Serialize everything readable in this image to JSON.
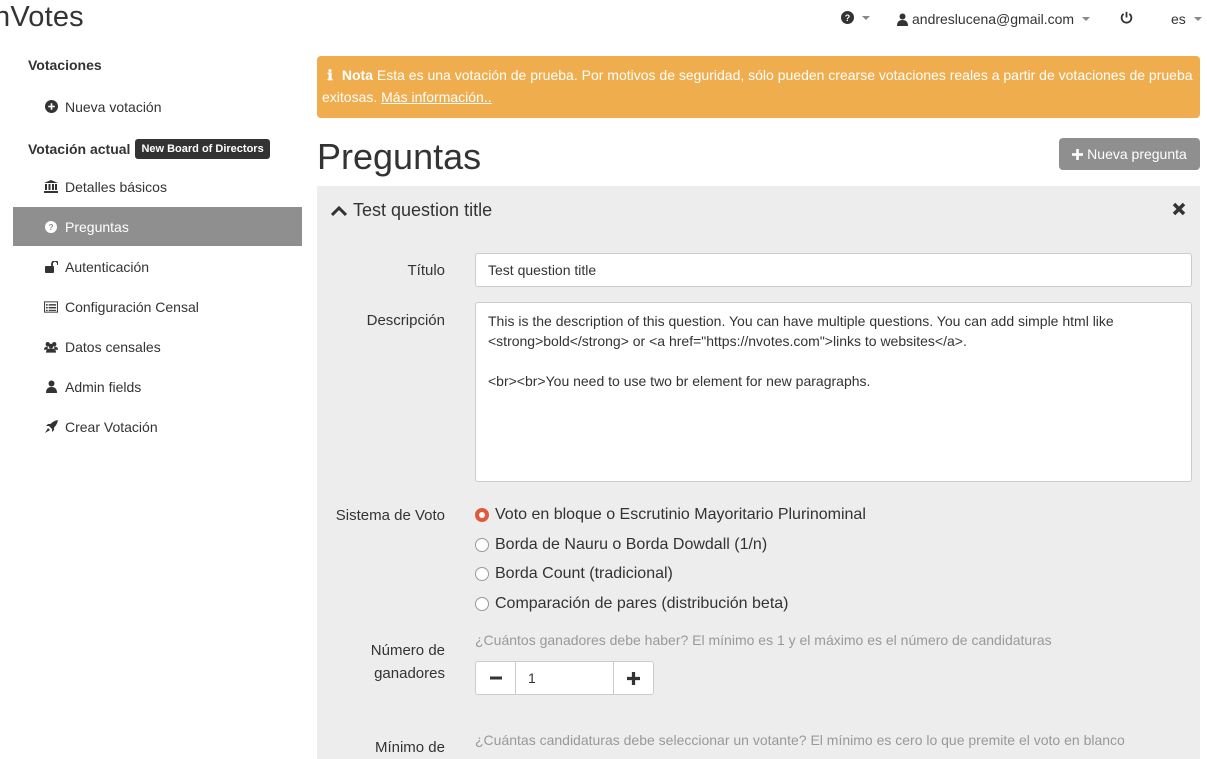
{
  "header": {
    "brand": "nVotes",
    "help_icon": "?",
    "user_email": "andreslucena@gmail.com",
    "language": "es"
  },
  "sidebar": {
    "section_votaciones": "Votaciones",
    "nueva_votacion": "Nueva votación",
    "section_actual": "Votación actual",
    "badge": "New Board of Directors",
    "items": [
      {
        "label": "Detalles básicos",
        "icon": "bank-icon"
      },
      {
        "label": "Preguntas",
        "icon": "question-circle-icon",
        "active": true
      },
      {
        "label": "Autenticación",
        "icon": "unlock-icon"
      },
      {
        "label": "Configuración Censal",
        "icon": "list-alt-icon"
      },
      {
        "label": "Datos censales",
        "icon": "users-icon"
      },
      {
        "label": "Admin fields",
        "icon": "user-icon"
      },
      {
        "label": "Crear Votación",
        "icon": "rocket-icon"
      }
    ]
  },
  "alert": {
    "title": "Nota",
    "text": "Esta es una votación de prueba. Por motivos de seguridad, sólo pueden crearse votaciones reales a partir de votaciones de prueba exitosas.",
    "link": "Más información.."
  },
  "main": {
    "title": "Preguntas",
    "new_button": "Nueva pregunta"
  },
  "question": {
    "header_title": "Test question title",
    "titulo_label": "Título",
    "titulo_value": "Test question title",
    "descripcion_label": "Descripción",
    "descripcion_line1": "This is the description of this question. You can have multiple questions. You can add simple html like",
    "descripcion_line2": "<strong>bold</strong> or <a href=\"https://nvotes.com\">links to websites</a>.",
    "descripcion_line3": "",
    "descripcion_line4": "<br><br>You need to use two br element for new paragraphs.",
    "sistema_label": "Sistema de Voto",
    "sistemas": [
      {
        "label": "Voto en bloque o Escrutinio Mayoritario Plurinominal",
        "checked": true
      },
      {
        "label": "Borda de Nauru o Borda Dowdall (1/n)",
        "checked": false
      },
      {
        "label": "Borda Count (tradicional)",
        "checked": false
      },
      {
        "label": "Comparación de pares (distribución beta)",
        "checked": false
      }
    ],
    "ganadores_label_1": "Número de",
    "ganadores_label_2": "ganadores",
    "ganadores_help": "¿Cuántos ganadores debe haber? El mínimo es 1 y el máximo es el número de candidaturas",
    "ganadores_value": "1",
    "minimo_label": "Mínimo de",
    "minimo_help": "¿Cuántas candidaturas debe seleccionar un votante? El mínimo es cero lo que premite el voto en blanco"
  },
  "colors": {
    "alert": "#f0ad4e",
    "active_sidebar": "#8f8f8f",
    "radio_checked": "#e05a3b",
    "panel_bg": "#ededed"
  }
}
